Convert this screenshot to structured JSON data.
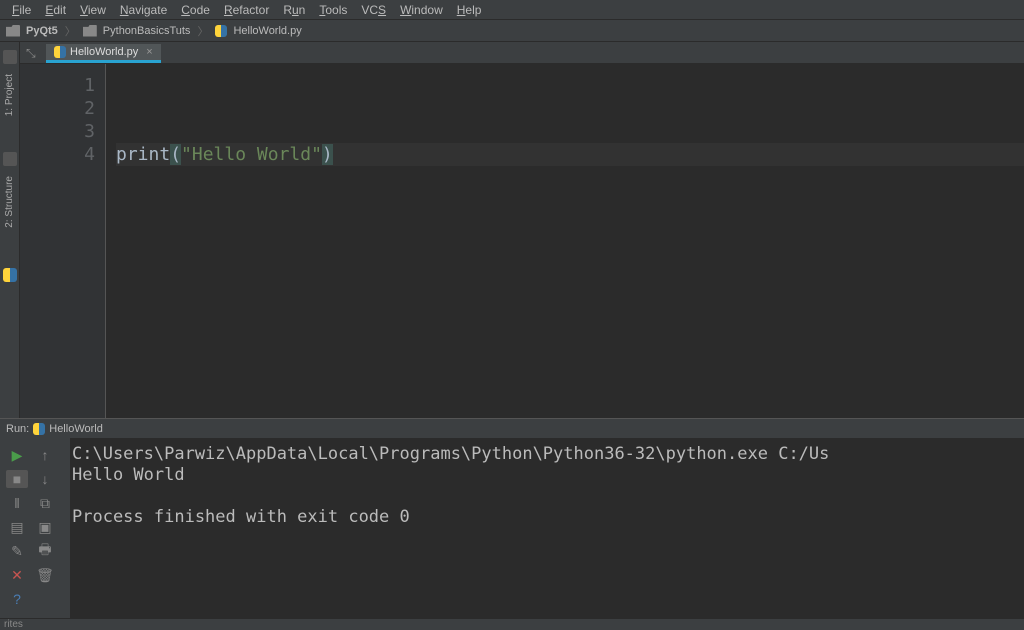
{
  "menu": [
    "File",
    "Edit",
    "View",
    "Navigate",
    "Code",
    "Refactor",
    "Run",
    "Tools",
    "VCS",
    "Window",
    "Help"
  ],
  "breadcrumb": {
    "project": "PyQt5",
    "folder": "PythonBasicsTuts",
    "file": "HelloWorld.py"
  },
  "sidebar": {
    "tab1": "1: Project",
    "tab2": "2: Structure"
  },
  "tab": {
    "file": "HelloWorld.py"
  },
  "editor": {
    "gutter": [
      "1",
      "2",
      "3",
      "4"
    ],
    "code_fn": "print",
    "code_open": "(",
    "code_str": "\"Hello World\"",
    "code_close": ")"
  },
  "run": {
    "label": "Run:",
    "config": "HelloWorld",
    "console_line1": "C:\\Users\\Parwiz\\AppData\\Local\\Programs\\Python\\Python36-32\\python.exe C:/Us",
    "console_line2": "Hello World",
    "console_line3": "",
    "console_line4": "Process finished with exit code 0"
  },
  "statusbar_left": "rites"
}
